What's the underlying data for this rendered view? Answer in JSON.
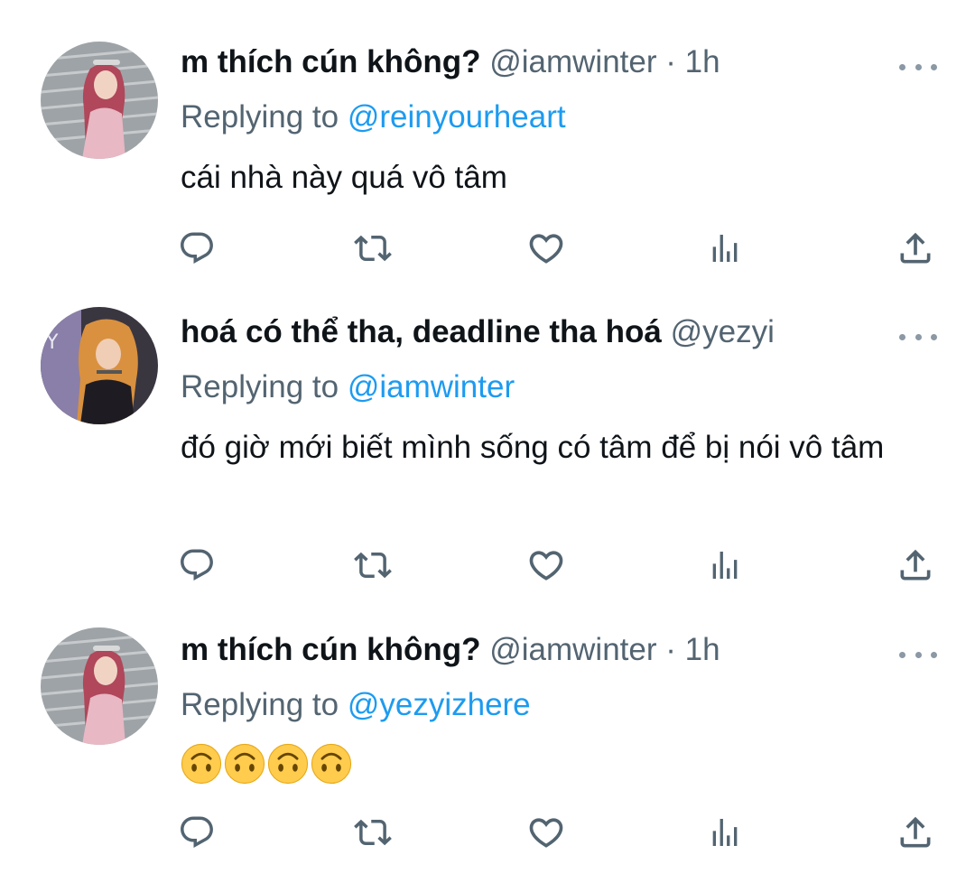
{
  "tweets": [
    {
      "display_name": "m thích cún không?",
      "handle": "@iamwinter",
      "separator": "·",
      "time": "1h",
      "replying_prefix": "Replying to ",
      "replying_to": "@reinyourheart",
      "text": "cái nhà này quá vô tâm",
      "actions": [
        "reply-icon",
        "retweet-icon",
        "like-icon",
        "views-icon",
        "share-icon"
      ]
    },
    {
      "display_name": "hoá có thể tha, deadline tha hoá",
      "handle": "@yezyi",
      "separator": "",
      "time": "",
      "replying_prefix": "Replying to ",
      "replying_to": "@iamwinter",
      "text": "đó giờ mới biết mình sống có tâm để bị nói vô tâm",
      "actions": [
        "reply-icon",
        "retweet-icon",
        "like-icon",
        "views-icon",
        "share-icon"
      ]
    },
    {
      "display_name": "m thích cún không?",
      "handle": "@iamwinter",
      "separator": "·",
      "time": "1h",
      "replying_prefix": "Replying to ",
      "replying_to": "@yezyizhere",
      "text": "🙃🙃🙃🙃",
      "emoji_name": "upside-down-face",
      "emoji_count": 4,
      "actions": [
        "reply-icon",
        "retweet-icon",
        "like-icon",
        "views-icon",
        "share-icon"
      ]
    }
  ],
  "colors": {
    "text_primary": "#0f1419",
    "text_secondary": "#536471",
    "link": "#1d9bf0",
    "icon": "#536471",
    "more_dots": "#8b98a5"
  }
}
